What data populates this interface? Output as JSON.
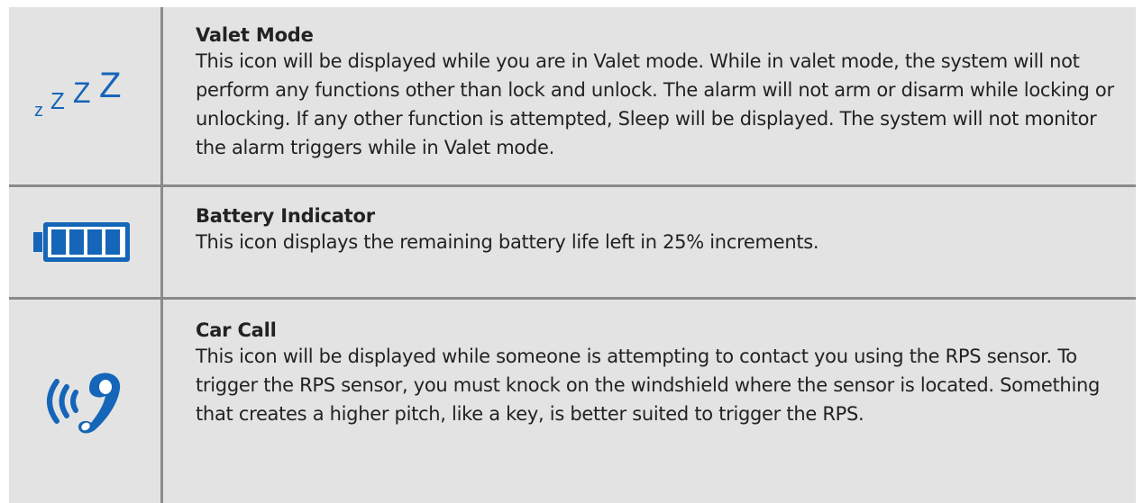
{
  "accent_color": "#1565b8",
  "items": [
    {
      "icon": "sleep-zzz-icon",
      "title": "Valet Mode",
      "description": "This icon will be displayed while you are in Valet mode. While in valet mode, the system will not perform any functions other than lock and unlock. The alarm will not arm or disarm while locking or unlocking. If any other function is attempted, Sleep will be displayed. The system will not monitor the alarm triggers while in Valet mode."
    },
    {
      "icon": "battery-icon",
      "title": "Battery Indicator",
      "description": "This icon displays the remaining battery life left in 25% increments."
    },
    {
      "icon": "car-call-icon",
      "title": "Car Call",
      "description": "This icon will be displayed while someone is attempting to contact you using the RPS sensor. To trigger the RPS sensor, you must knock on the windshield where the sensor is located. Something that creates a higher pitch, like a key, is better suited to trigger the RPS."
    }
  ]
}
